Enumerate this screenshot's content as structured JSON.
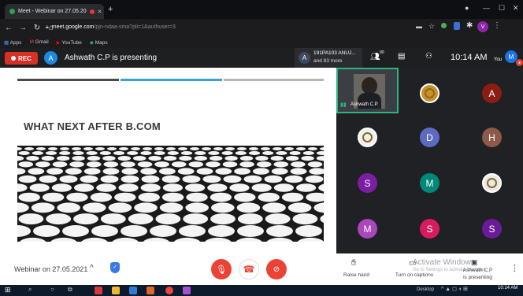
{
  "browser": {
    "tab_title": "Meet - Webinar on 27.05.20",
    "new_tab": "+",
    "url_main": "meet.google.com",
    "url_path": "/pjn-ndaa-sma?pli=1&authuser=3",
    "bookmarks": [
      "Apps",
      "Gmail",
      "YouTube",
      "Maps"
    ]
  },
  "meet_header": {
    "rec_label": "REC",
    "presenter_initial": "A",
    "presenter_text": "Ashwath C.P is presenting",
    "viewer_initial": "A",
    "viewer_line1": "191PA103 ANUJ...",
    "viewer_line2": "and 83 more",
    "participant_count": "90",
    "time": "10:14 AM",
    "you_label": "You",
    "you_initial": "M"
  },
  "slide": {
    "title": "WHAT NEXT AFTER B.COM",
    "bar_colors": [
      "#4a4a4a",
      "#3aa0d8",
      "#b5b5b5"
    ]
  },
  "grid": {
    "video_name": "Ashwath C.P.",
    "tiles": [
      {
        "initial": "",
        "color": "#c9902c",
        "kind": "img"
      },
      {
        "initial": "A",
        "color": "#8b1d14",
        "kind": "letter"
      },
      {
        "initial": "",
        "color": "#f1f1f1",
        "kind": "img"
      },
      {
        "initial": "D",
        "color": "#5c6bc0",
        "kind": "letter"
      },
      {
        "initial": "H",
        "color": "#8d5a4a",
        "kind": "letter"
      },
      {
        "initial": "S",
        "color": "#7b1fa2",
        "kind": "letter"
      },
      {
        "initial": "M",
        "color": "#00897b",
        "kind": "letter"
      },
      {
        "initial": "",
        "color": "#e8e8e8",
        "kind": "img"
      },
      {
        "initial": "M",
        "color": "#ab47bc",
        "kind": "letter"
      },
      {
        "initial": "S",
        "color": "#d81b60",
        "kind": "letter"
      },
      {
        "initial": "S",
        "color": "#6a1b9a",
        "kind": "letter"
      }
    ]
  },
  "bottom": {
    "meeting_name": "Webinar on 27.05.2021",
    "raise_hand": "Raise hand",
    "captions": "Turn on captions",
    "presenting_name": "Ashwath C.P",
    "presenting_status": "is presenting",
    "watermark_line1": "Activate Windows",
    "watermark_line2": "Go to Settings to activate Windows."
  },
  "taskbar": {
    "desktop": "Desktop",
    "clock": "10:14 AM"
  }
}
